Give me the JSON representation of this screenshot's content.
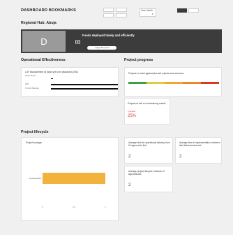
{
  "header": {
    "title": "DASHBOARD BOOKMARKS",
    "toggle_a": "",
    "toggle_b": "",
    "toggle_c": "",
    "toggle_d": "",
    "period_select": "Year, Month",
    "seg_1": "",
    "seg_2": ""
  },
  "hub": {
    "title": "Regional Hub: Abuja",
    "avatar_letter": "D",
    "kpi_text": "Funds deployed timely and efficiently",
    "kpi_chip": "1 target this period"
  },
  "operational": {
    "title": "Operational Effectiveness",
    "card_title": "LUF disbursement vs funds yet to be disbursed (LRD)",
    "card_sub": "Select Month",
    "legend": "",
    "row1_label": "LRD",
    "row2_label": "% of LF Planning",
    "row1_value": 0.98,
    "row2_value": 0.98
  },
  "progress": {
    "title": "Project progress",
    "gauge_title": "Projects on track against planned outputs and outcomes",
    "gauge_colors": [
      "#3aa14a",
      "#e8c93b",
      "#f0a830",
      "#e8892b",
      "#d83a2a"
    ],
    "risk_title": "Projects at risk of not achieving results",
    "risk_sub": "3 projects",
    "risk_value": "25%"
  },
  "lifecycle": {
    "title": "Project lifecycle",
    "chart_title": "Project by stage",
    "bar_label": "Implementation",
    "bar_color": "#f2b33d",
    "axis_ticks": [
      "0",
      "0.5",
      "1"
    ],
    "card1_title": "Average time for operational delivery, from IC approval to first",
    "card1_value": "2",
    "card2_title": "Average time to implementation, between first disbursement and",
    "card2_value": "2",
    "card3_title": "Average project lifecycle, between IC approval and",
    "card3_value": "2"
  },
  "chart_data": {
    "type": "bar",
    "title": "Project by stage",
    "categories": [
      "Implementation"
    ],
    "values": [
      1
    ],
    "xlim": [
      0,
      1
    ],
    "orientation": "horizontal"
  }
}
